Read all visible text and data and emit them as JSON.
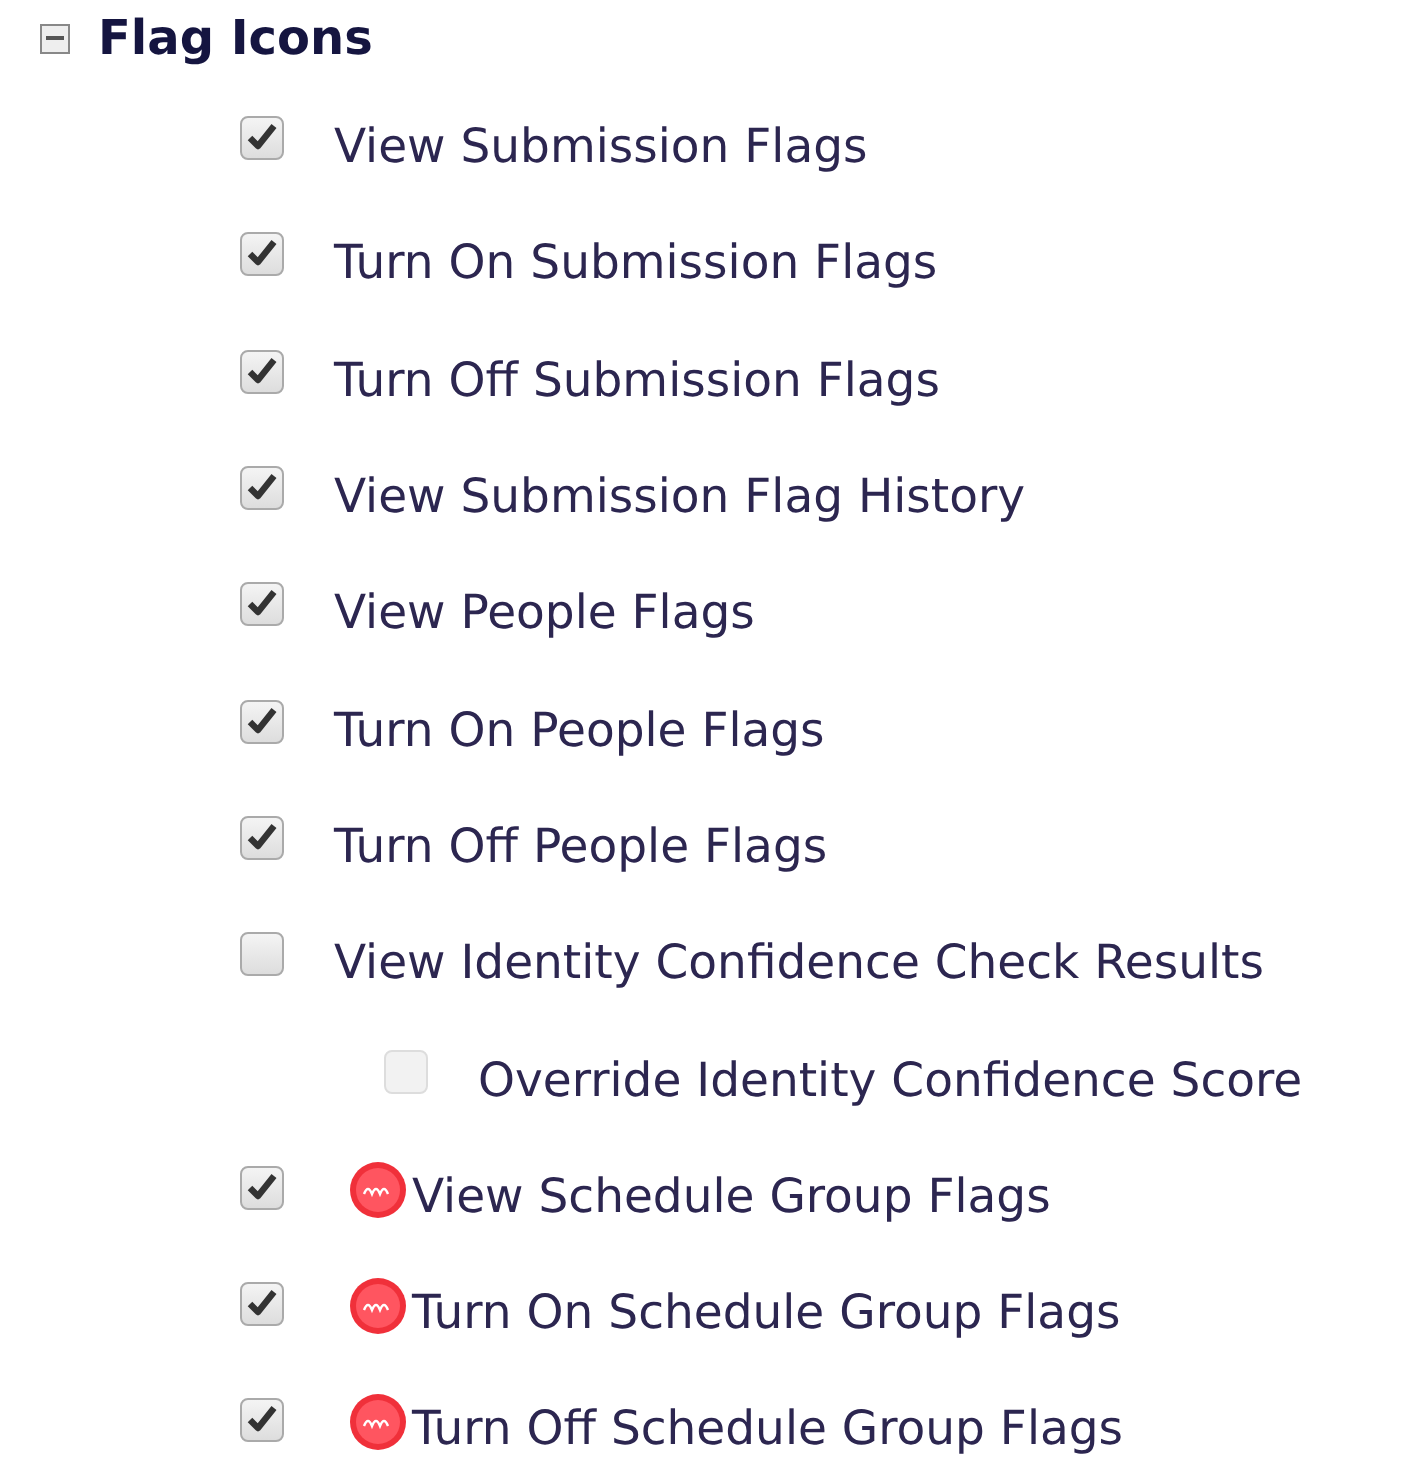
{
  "group": {
    "title": "Flag Icons",
    "expanded": true,
    "items": [
      {
        "label": "View Submission Flags",
        "kind": "plain",
        "checked": true,
        "disabled": false
      },
      {
        "label": "Turn On Submission Flags",
        "kind": "plain",
        "checked": true,
        "disabled": false
      },
      {
        "label": "Turn Off Submission Flags",
        "kind": "plain",
        "checked": true,
        "disabled": false
      },
      {
        "label": "View Submission Flag History",
        "kind": "plain",
        "checked": true,
        "disabled": false
      },
      {
        "label": "View People Flags",
        "kind": "plain",
        "checked": true,
        "disabled": false
      },
      {
        "label": "Turn On People Flags",
        "kind": "plain",
        "checked": true,
        "disabled": false
      },
      {
        "label": "Turn Off People Flags",
        "kind": "plain",
        "checked": true,
        "disabled": false
      },
      {
        "label": "View Identity Confidence Check Results",
        "kind": "plain",
        "checked": false,
        "disabled": false,
        "children": [
          {
            "label": "Override Identity Confidence Score",
            "checked": false,
            "disabled": true
          }
        ]
      },
      {
        "label": "View Schedule Group Flags",
        "kind": "badge",
        "checked": true,
        "disabled": false
      },
      {
        "label": "Turn On Schedule Group Flags",
        "kind": "badge",
        "checked": true,
        "disabled": false
      },
      {
        "label": "Turn Off Schedule Group Flags",
        "kind": "badge",
        "checked": true,
        "disabled": false
      }
    ]
  }
}
